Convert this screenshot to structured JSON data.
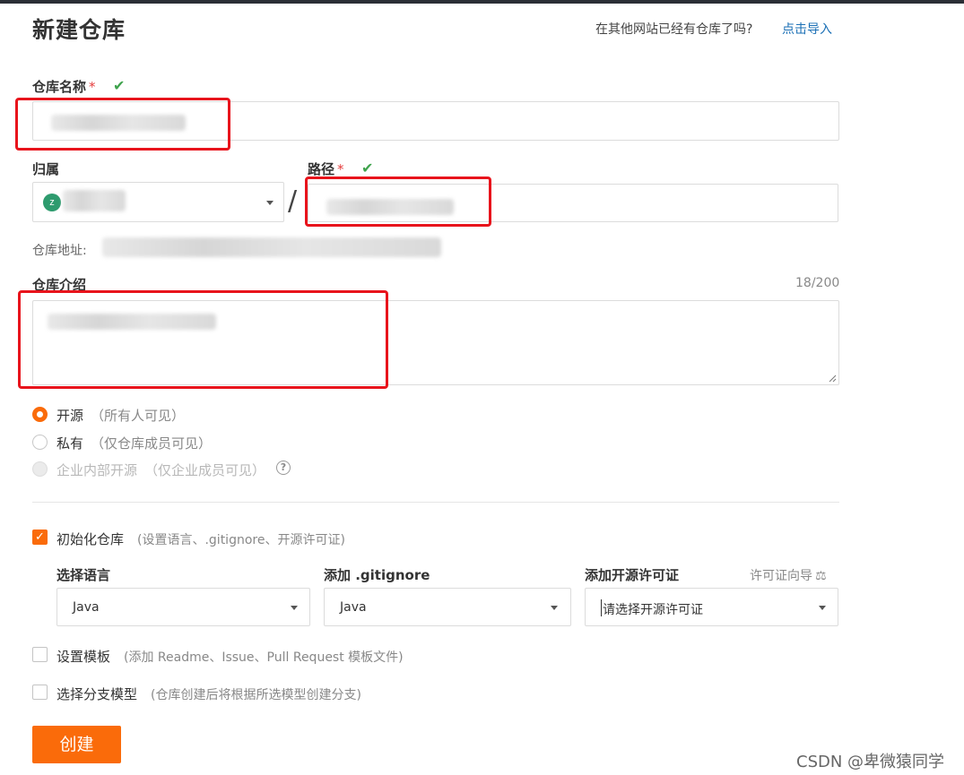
{
  "header": {
    "title": "新建仓库",
    "import_prompt": "在其他网站已经有仓库了吗?",
    "import_link": "点击导入"
  },
  "repo_name": {
    "label": "仓库名称",
    "required_mark": "*",
    "valid_mark": "✔"
  },
  "owner": {
    "label": "归属",
    "avatar_letter": "z"
  },
  "separator": "/",
  "path": {
    "label": "路径",
    "required_mark": "*",
    "valid_mark": "✔"
  },
  "repo_address": {
    "label": "仓库地址:"
  },
  "description": {
    "label": "仓库介绍",
    "counter": "18/200"
  },
  "visibility": {
    "options": [
      {
        "label": "开源",
        "hint": "（所有人可见）",
        "selected": true,
        "disabled": false
      },
      {
        "label": "私有",
        "hint": "（仅仓库成员可见）",
        "selected": false,
        "disabled": false
      },
      {
        "label": "企业内部开源",
        "hint": "（仅企业成员可见）",
        "selected": false,
        "disabled": true
      }
    ],
    "help_icon": "?"
  },
  "init_repo": {
    "label": "初始化仓库",
    "hint": "(设置语言、.gitignore、开源许可证)",
    "checked": true,
    "language": {
      "label": "选择语言",
      "value": "Java"
    },
    "gitignore": {
      "label": "添加 .gitignore",
      "value": "Java"
    },
    "license": {
      "label": "添加开源许可证",
      "placeholder": "请选择开源许可证",
      "guide_link": "许可证向导",
      "guide_icon": "⚖"
    }
  },
  "template": {
    "label": "设置模板",
    "hint": "(添加 Readme、Issue、Pull Request 模板文件)",
    "checked": false
  },
  "branch_model": {
    "label": "选择分支模型",
    "hint": "(仓库创建后将根据所选模型创建分支)",
    "checked": false
  },
  "submit": {
    "label": "创建"
  },
  "watermark": "CSDN @卑微猿同学",
  "colors": {
    "accent": "#fa6b0a",
    "link": "#1a6fb5",
    "valid": "#3fa34d",
    "annotation": "#e8141c"
  }
}
